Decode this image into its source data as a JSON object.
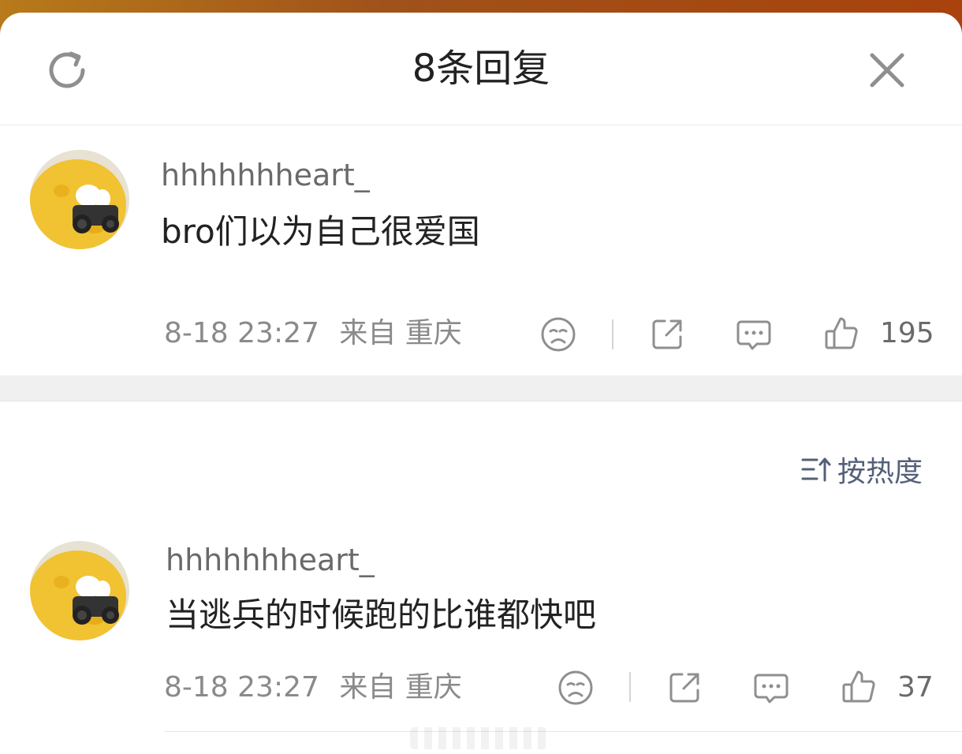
{
  "header": {
    "title": "8条回复",
    "refresh_icon": "refresh-icon",
    "close_icon": "close-icon"
  },
  "colors": {
    "top_bar_gradient": [
      "#b87a1a",
      "#a9420d"
    ],
    "text_primary": "#222222",
    "text_secondary": "#8a8a8a",
    "sort_accent": "#546079"
  },
  "comments": [
    {
      "username": "hhhhhhheart_",
      "text": "bro们以为自己很爱国",
      "time": "8-18 23:27",
      "location": "来自 重庆",
      "likes": "195"
    },
    {
      "username": "hhhhhhheart_",
      "text": "当逃兵的时候跑的比谁都快吧",
      "time": "8-18 23:27",
      "location": "来自 重庆",
      "likes": "37"
    }
  ],
  "sort": {
    "label": "按热度",
    "icon": "sort-icon"
  },
  "action_icons": [
    "dislike-icon",
    "share-icon",
    "comment-icon",
    "like-icon"
  ]
}
